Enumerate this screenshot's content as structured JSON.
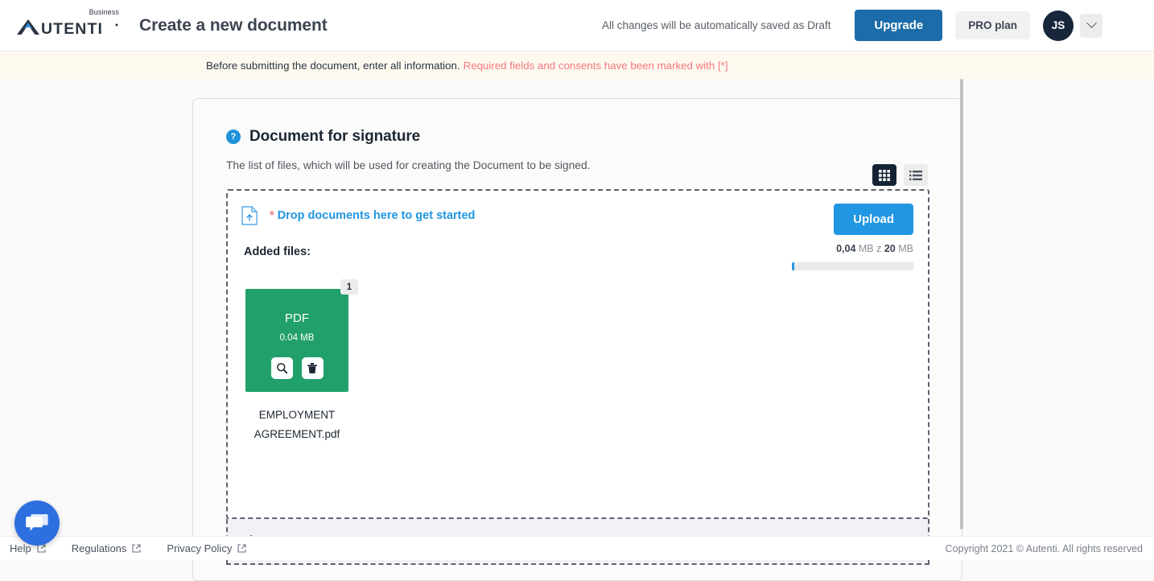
{
  "header": {
    "logo_text": "AUTENTI",
    "logo_superscript": "Business",
    "page_title": "Create a new document",
    "draft_note": "All changes will be automatically saved as Draft",
    "upgrade_label": "Upgrade",
    "pro_plan_label": "PRO plan",
    "avatar_initials": "JS"
  },
  "banner": {
    "text_primary": "Before submitting the document, enter all information.",
    "text_required": "Required fields and consents have been marked with [*]"
  },
  "card": {
    "help_icon_label": "?",
    "title": "Document for signature",
    "subtitle": "The list of files, which will be used for creating the Document to be signed."
  },
  "dropzone": {
    "asterisk": "*",
    "label": "Drop documents here to get started",
    "upload_label": "Upload",
    "added_files_label": "Added files:",
    "quota_used": "0,04",
    "quota_used_unit": "MB z",
    "quota_total": "20",
    "quota_total_unit": "MB",
    "progress_percent": 2
  },
  "file": {
    "badge": "1",
    "type": "PDF",
    "size": "0.04 MB",
    "name_line1": "EMPLOYMENT",
    "name_line2": "AGREEMENT.pdf"
  },
  "additional": {
    "label": "Additional information"
  },
  "footer": {
    "help_label": "Help",
    "regulations_label": "Regulations",
    "privacy_label": "Privacy Policy",
    "copyright": "Copyright 2021 © Autenti. All rights reserved"
  },
  "colors": {
    "brand_blue": "#2196e3",
    "upgrade_blue": "#1b6ca8",
    "required_red": "#f4777f",
    "pdf_green": "#22a06b",
    "avatar_navy": "#17263b",
    "banner_bg": "#fdf9ef"
  }
}
